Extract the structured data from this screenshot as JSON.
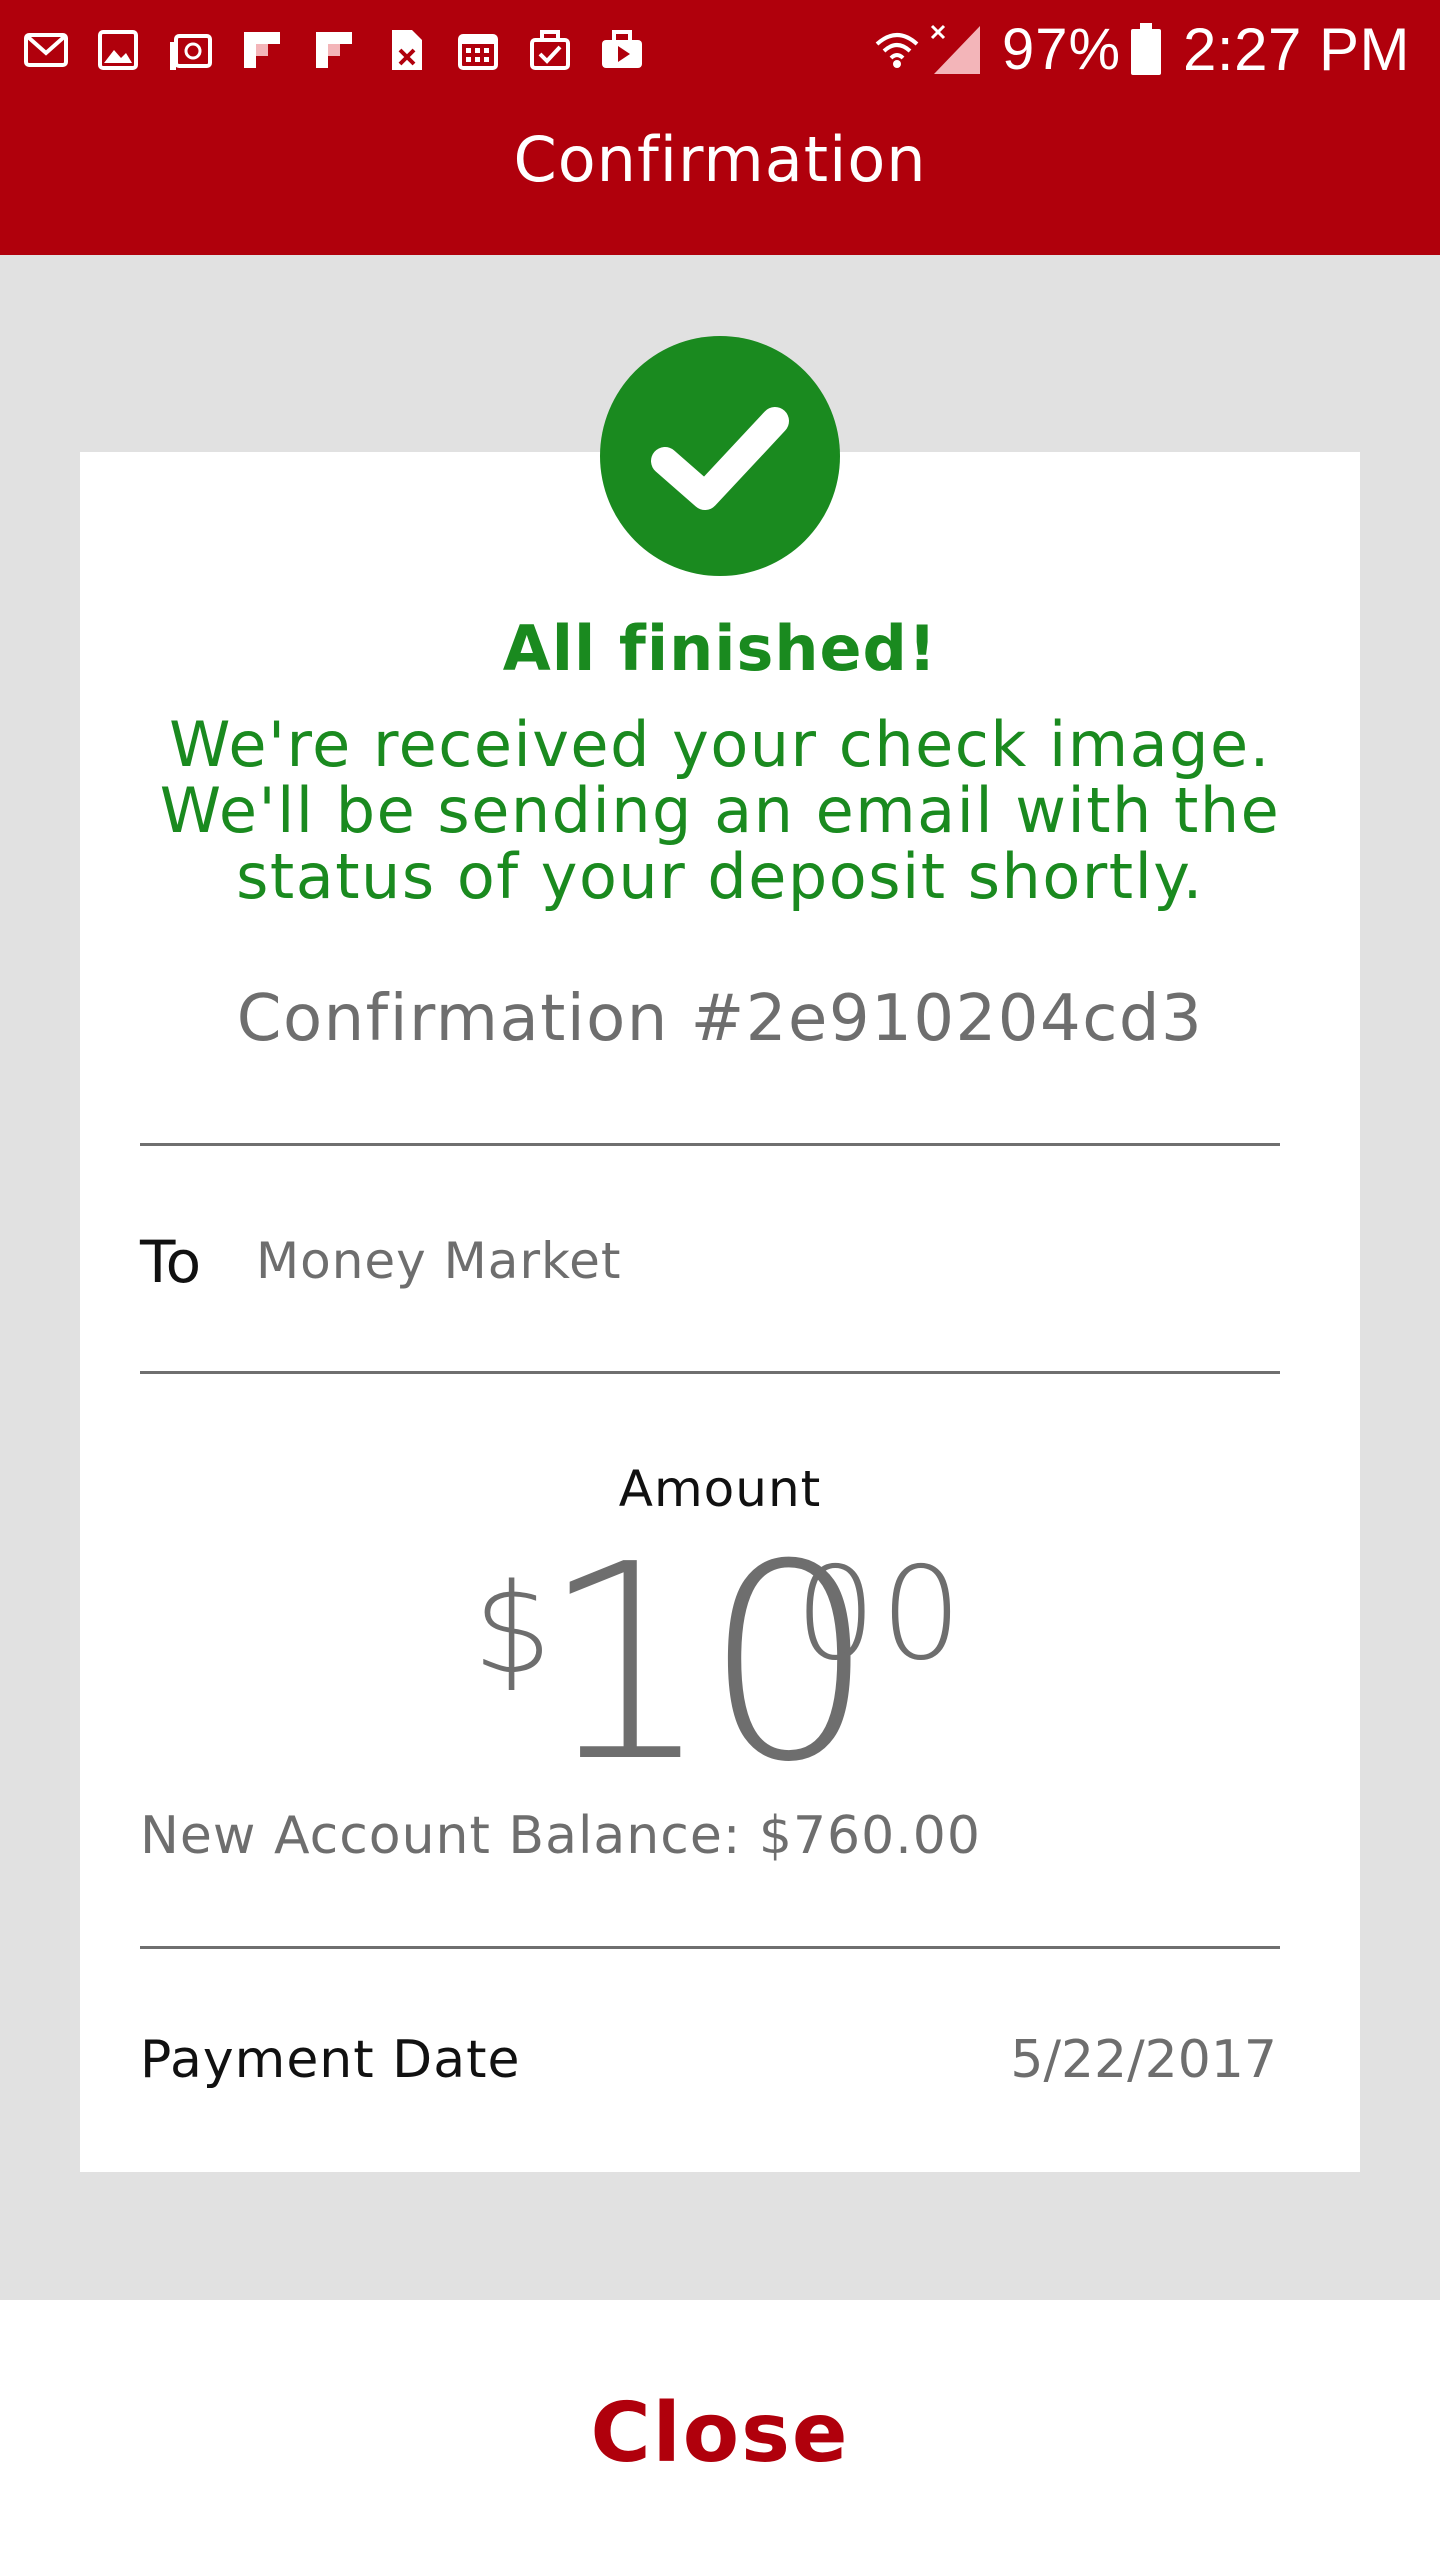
{
  "status_bar": {
    "left_icons": [
      "gmail-icon",
      "gallery-icon",
      "email-icon",
      "flipboard-icon",
      "flipboard-icon",
      "document-icon",
      "calendar-icon",
      "task-icon",
      "briefcase-icon"
    ],
    "battery_percent": "97%",
    "time": "2:27 PM"
  },
  "app_bar": {
    "title": "Confirmation"
  },
  "confirmation": {
    "heading": "All finished!",
    "message_lines": [
      "We're received your check image.",
      "We'll be sending an email with the",
      "status of your deposit shortly."
    ],
    "confirmation_number": "Confirmation #2e910204cd3",
    "to_label": "To",
    "to_value": "Money Market",
    "amount_label": "Amount",
    "amount": {
      "currency": "$",
      "whole": "10",
      "cents": "00"
    },
    "new_balance": "New Account Balance: $760.00",
    "payment_date_label": "Payment Date",
    "payment_date_value": "5/22/2017"
  },
  "footer": {
    "close_label": "Close"
  },
  "colors": {
    "brand_red": "#b0000c",
    "success_green": "#1a8a1f",
    "background_gray": "#e1e1e1",
    "text_gray": "#6e6e6e"
  }
}
